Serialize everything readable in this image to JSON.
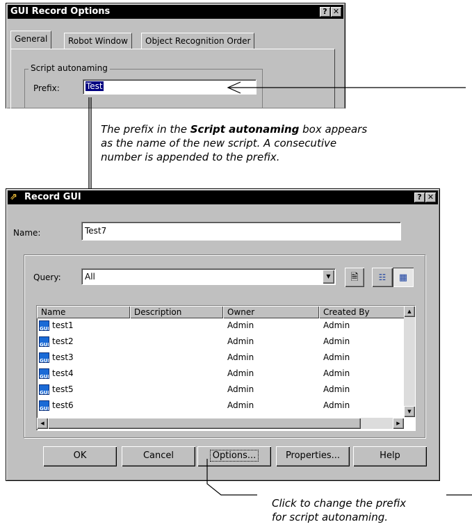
{
  "gui_record_options": {
    "title": "GUI Record Options",
    "help_btn": "?",
    "close_btn": "✕",
    "tabs": [
      "General",
      "Robot Window",
      "Object Recognition Order"
    ],
    "group_label": "Script autonaming",
    "prefix_label": "Prefix:",
    "prefix_value": "Test"
  },
  "annotation_top": {
    "line1_pre": "The prefix in the ",
    "line1_bold": "Script autonaming",
    "line1_post": " box appears",
    "line2": "as the name of the new script. A consecutive",
    "line3": "number is appended to the prefix."
  },
  "record_gui": {
    "title": "Record GUI",
    "help_btn": "?",
    "close_btn": "✕",
    "name_label": "Name:",
    "name_value": "Test7",
    "query_label": "Query:",
    "query_value": "All",
    "columns": [
      "Name",
      "Description",
      "Owner",
      "Created By"
    ],
    "rows": [
      {
        "name": "test1",
        "description": "",
        "owner": "Admin",
        "created_by": "Admin"
      },
      {
        "name": "test2",
        "description": "",
        "owner": "Admin",
        "created_by": "Admin"
      },
      {
        "name": "test3",
        "description": "",
        "owner": "Admin",
        "created_by": "Admin"
      },
      {
        "name": "test4",
        "description": "",
        "owner": "Admin",
        "created_by": "Admin"
      },
      {
        "name": "test5",
        "description": "",
        "owner": "Admin",
        "created_by": "Admin"
      },
      {
        "name": "test6",
        "description": "",
        "owner": "Admin",
        "created_by": "Admin"
      }
    ],
    "icon_text": "GUI",
    "buttons": {
      "ok": "OK",
      "cancel": "Cancel",
      "options": "Options...",
      "properties": "Properties...",
      "help": "Help"
    }
  },
  "annotation_bottom": {
    "line1": "Click to change the prefix",
    "line2": "for script autonaming."
  }
}
